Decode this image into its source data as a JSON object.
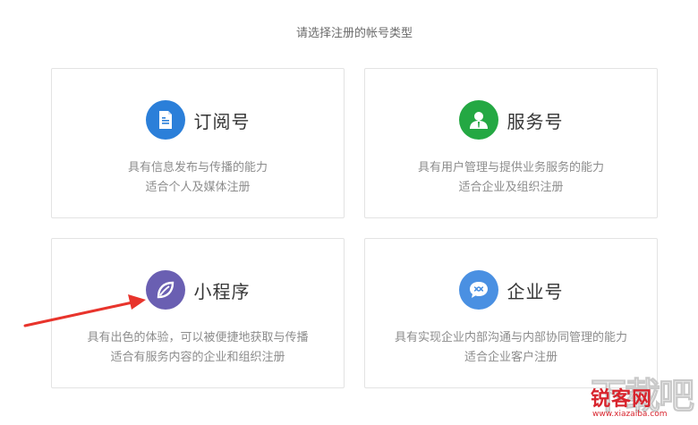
{
  "page": {
    "heading": "请选择注册的帐号类型"
  },
  "cards": [
    {
      "title": "订阅号",
      "line1": "具有信息发布与传播的能力",
      "line2": "适合个人及媒体注册",
      "icon": "document-icon",
      "color": "#2b7fd9"
    },
    {
      "title": "服务号",
      "line1": "具有用户管理与提供业务服务的能力",
      "line2": "适合企业及组织注册",
      "icon": "person-icon",
      "color": "#24a843"
    },
    {
      "title": "小程序",
      "line1": "具有出色的体验，可以被便捷地获取与传播",
      "line2": "适合有服务内容的企业和组织注册",
      "icon": "leaf-icon",
      "color": "#6a5fb2"
    },
    {
      "title": "企业号",
      "line1": "具有实现企业内部沟通与内部协同管理的能力",
      "line2": "适合企业客户注册",
      "icon": "chat-bubble-icon",
      "color": "#4a90e2"
    }
  ],
  "annotation": {
    "arrow_color": "#e8342c"
  },
  "watermark": {
    "big_text": "下载吧",
    "brand": "锐客网",
    "url": "www.xiazaiba.com"
  }
}
